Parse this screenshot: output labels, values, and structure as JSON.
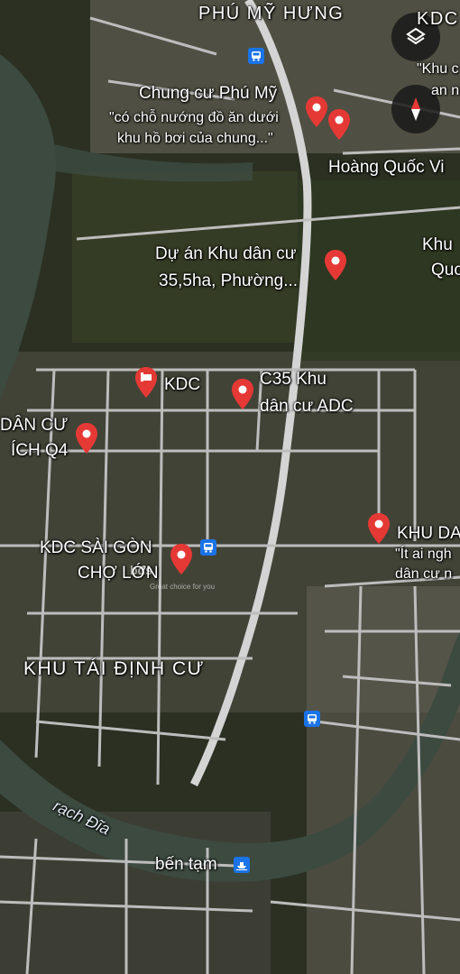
{
  "areas": {
    "phu_my_hung": "PHÚ MỸ HƯNG",
    "kdc_top_right": "KDC",
    "khu_tai_dinh_cu": "KHU TÁI ĐỊNH CƯ",
    "khu_right": "Khu",
    "quc_right": "Quc",
    "dan_cu_left": "DÂN CƯ",
    "ich_q4": "ÍCH Q4",
    "kdc_sai_gon": "KDC SÀI GÒN",
    "cho_lon": "CHỢ LỚN",
    "khu_da": "KHU DA"
  },
  "places": {
    "chung_cu_phu_my": {
      "title": "Chung cư Phú Mỹ",
      "note1": "\"có chỗ nướng đồ ăn dưới",
      "note2": "khu hồ bơi của chung...\""
    },
    "hoang_quoc_viet": "Hoàng Quốc Vi",
    "khu_top_note": "\"Khu c",
    "an_note": "an n",
    "du_an": {
      "line1": "Dự án Khu dân cư",
      "line2": "35,5ha, Phường..."
    },
    "kdc_hotel": "KDC",
    "c35": {
      "line1": "C35 Khu",
      "line2": "dân cư ADC"
    },
    "it_ai": {
      "line1": "\"Ít ai ngh",
      "line2": "dân cư n"
    },
    "ben_tam": "bến tạm",
    "rach_dia": "rạch Đĩa"
  },
  "watermark": {
    "brand": "bđs",
    "tagline": "Great choice for you"
  },
  "colors": {
    "pin": "#e53935",
    "transit": "#1a73e8",
    "road": "#c9c9c9",
    "river": "#3c4a40",
    "vegetation": "#2f3b22"
  },
  "icons": {
    "layers": "layers-icon",
    "compass": "compass-icon",
    "pin": "map-pin-icon",
    "bus": "bus-icon",
    "ferry": "ferry-icon",
    "hotel": "hotel-icon"
  }
}
